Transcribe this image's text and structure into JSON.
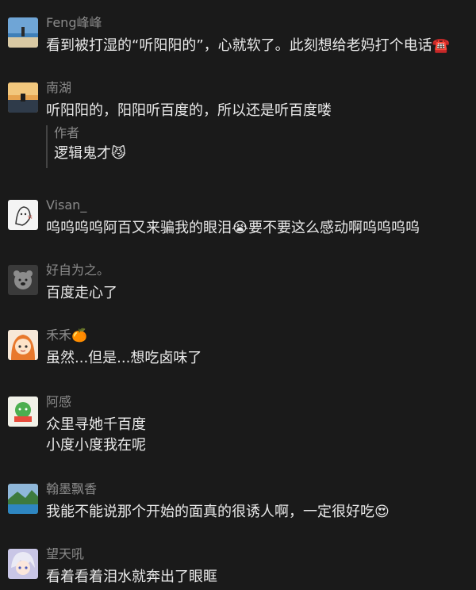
{
  "comments": [
    {
      "name": "Feng峰峰",
      "lines": [
        "看到被打湿的“听阳阳的”，心就软了。此刻想给老妈打个电话☎️"
      ],
      "avatar": "beach-photo-avatar"
    },
    {
      "name": "南湖",
      "lines": [
        "听阳阳的，阳阳听百度的，所以还是听百度喽"
      ],
      "avatar": "sunset-photo-avatar",
      "reply": {
        "name": "作者",
        "text": "逻辑鬼才😼"
      }
    },
    {
      "name": "Visan_",
      "lines": [
        "呜呜呜呜阿百又来骗我的眼泪😭要不要这么感动啊呜呜呜呜"
      ],
      "avatar": "sketch-girl-avatar"
    },
    {
      "name": "好自为之。",
      "lines": [
        "百度走心了"
      ],
      "avatar": "bear-avatar"
    },
    {
      "name": "禾禾🍊",
      "lines": [
        "虽然...但是...想吃卤味了"
      ],
      "avatar": "anime-girl-avatar"
    },
    {
      "name": "阿感",
      "lines": [
        "众里寻她千百度",
        "小度小度我在呢"
      ],
      "avatar": "cartoon-card-avatar"
    },
    {
      "name": "翰墨飘香",
      "lines": [
        "我能不能说那个开始的面真的很诱人啊，一定很好吃😍"
      ],
      "avatar": "lake-photo-avatar"
    },
    {
      "name": "望天吼",
      "lines": [
        "看着看着泪水就奔出了眼眶"
      ],
      "avatar": "anime-boy-avatar"
    }
  ]
}
